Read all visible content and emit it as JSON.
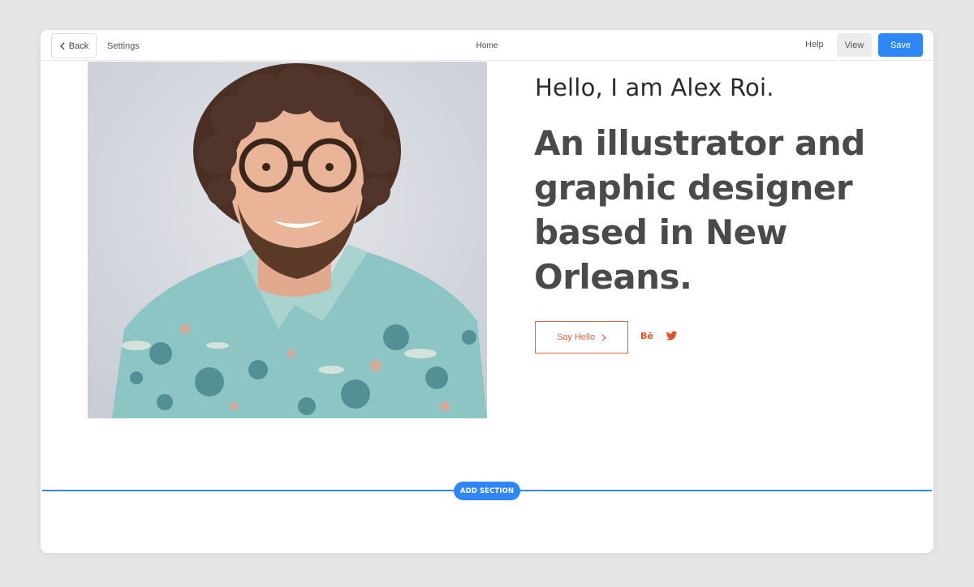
{
  "topbar": {
    "back_label": "Back",
    "settings_label": "Settings",
    "page_name": "Home",
    "help_label": "Help",
    "view_label": "View",
    "save_label": "Save"
  },
  "hero": {
    "intro": "Hello, I am Alex Roi.",
    "headline": "An illustrator and graphic designer based in New Orleans.",
    "cta_label": "Say Hello",
    "social": {
      "behance_label": "Bē",
      "twitter_icon": "twitter-icon"
    }
  },
  "editor": {
    "add_section_label": "ADD SECTION"
  },
  "colors": {
    "accent": "#2f86f6",
    "cta": "#e2643f",
    "headline": "#4a4a4a"
  }
}
